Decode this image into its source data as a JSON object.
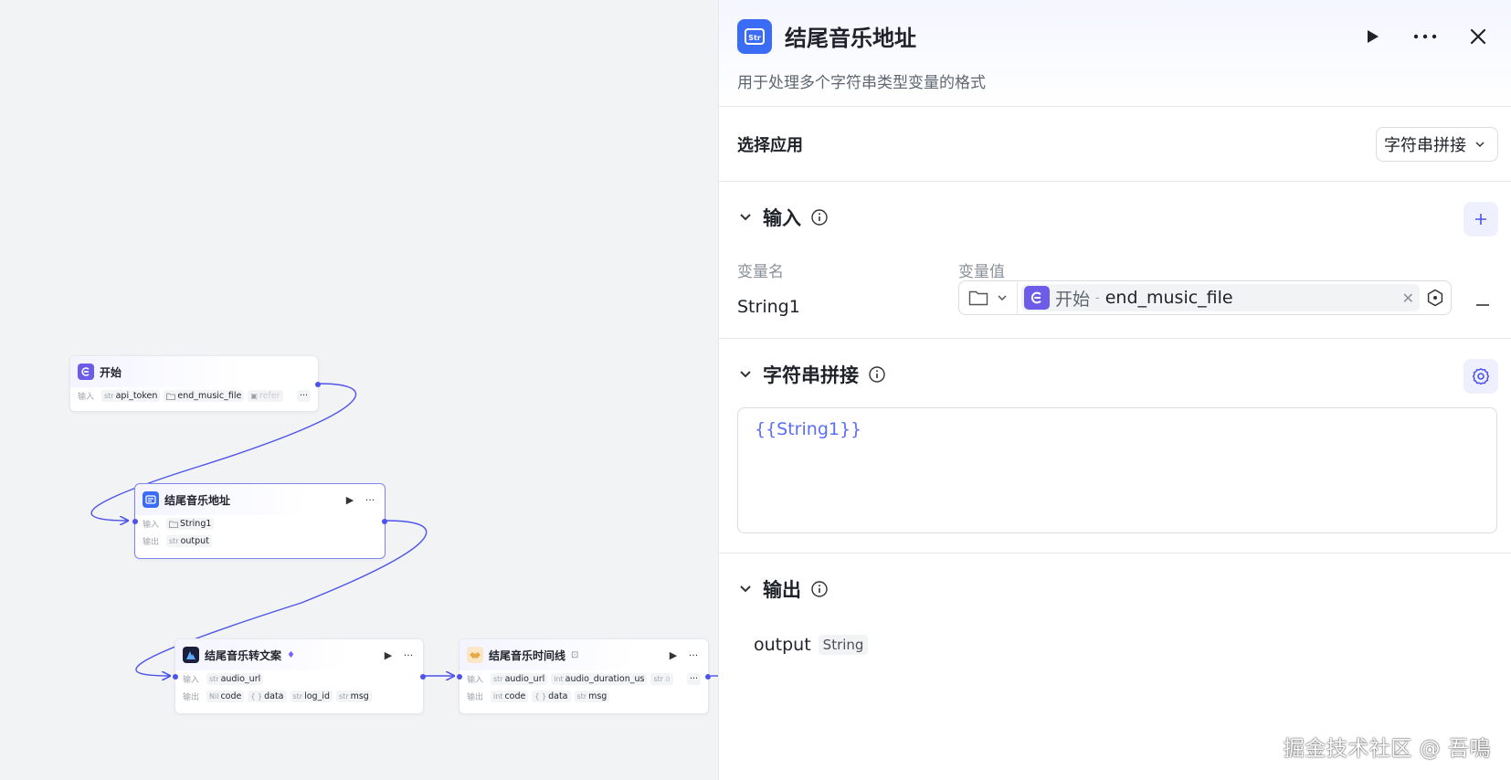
{
  "canvas": {
    "nodes": {
      "start": {
        "title": "开始",
        "input_label": "输入",
        "inputs": [
          {
            "type": "str",
            "name": "api_token"
          },
          {
            "type": "folder",
            "name": "end_music_file"
          },
          {
            "type": "img",
            "name": "refer"
          }
        ],
        "more": "···"
      },
      "end_music_addr": {
        "title": "结尾音乐地址",
        "input_label": "输入",
        "output_label": "输出",
        "inputs": [
          {
            "type": "folder",
            "name": "String1"
          }
        ],
        "outputs": [
          {
            "type": "str",
            "name": "output"
          }
        ],
        "run": "▶",
        "more": "···"
      },
      "music_to_text": {
        "title": "结尾音乐转文案",
        "badge": "♦",
        "input_label": "输入",
        "output_label": "输出",
        "inputs": [
          {
            "type": "str",
            "name": "audio_url"
          }
        ],
        "outputs": [
          {
            "type": "Nil",
            "name": "code"
          },
          {
            "type": "{ }",
            "name": "data"
          },
          {
            "type": "str",
            "name": "log_id"
          },
          {
            "type": "str",
            "name": "msg"
          }
        ],
        "run": "▶",
        "more": "···"
      },
      "music_timeline": {
        "title": "结尾音乐时间线",
        "badge": "⊡",
        "input_label": "输入",
        "output_label": "输出",
        "inputs": [
          {
            "type": "str",
            "name": "audio_url"
          },
          {
            "type": "int",
            "name": "audio_duration_us"
          },
          {
            "type": "str",
            "name": "a"
          }
        ],
        "outputs": [
          {
            "type": "int",
            "name": "code"
          },
          {
            "type": "{ }",
            "name": "data"
          },
          {
            "type": "str",
            "name": "msg"
          }
        ],
        "run": "▶",
        "more": "···"
      }
    }
  },
  "panel": {
    "title": "结尾音乐地址",
    "icon_label": "Str",
    "description": "用于处理多个字符串类型变量的格式",
    "app_section": {
      "label": "选择应用",
      "selected": "字符串拼接"
    },
    "input_section": {
      "title": "输入",
      "col_name": "变量名",
      "col_value": "变量值",
      "rows": [
        {
          "name": "String1",
          "ref_source": "开始",
          "ref_sep": "-",
          "ref_field": "end_music_file"
        }
      ]
    },
    "concat_section": {
      "title": "字符串拼接",
      "template": "{{String1}}"
    },
    "output_section": {
      "title": "输出",
      "outputs": [
        {
          "name": "output",
          "type": "String"
        }
      ]
    }
  },
  "watermark": "掘金技术社区 @ 吾鳴",
  "colors": {
    "accent": "#4d53e8",
    "node_icon_purple": "#6c5ce7",
    "panel_icon_blue": "#3b6cf6",
    "template_text": "#5b6ef5"
  }
}
